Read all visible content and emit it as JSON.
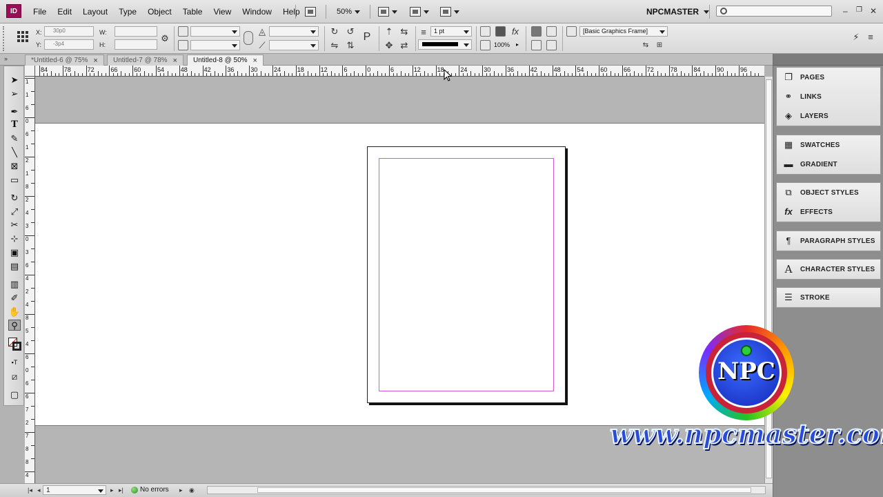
{
  "app": {
    "logo_text": "ID",
    "workspace": "NPCMASTER"
  },
  "menu": {
    "items": [
      "File",
      "Edit",
      "Layout",
      "Type",
      "Object",
      "Table",
      "View",
      "Window",
      "Help"
    ]
  },
  "menubar": {
    "zoom": "50%"
  },
  "control": {
    "x_label": "X:",
    "x_value": "30p0",
    "y_label": "Y:",
    "y_value": "-3p4",
    "w_label": "W:",
    "h_label": "H:",
    "stroke_weight": "1 pt",
    "opacity": "100%",
    "object_style": "[Basic Graphics Frame]"
  },
  "tabs": [
    {
      "label": "*Untitled-6 @ 75%",
      "close": "×"
    },
    {
      "label": "Untitled-7 @ 78%",
      "close": "×"
    },
    {
      "label": "Untitled-8 @ 50%",
      "close": "×"
    }
  ],
  "ruler": {
    "h_labels": [
      "84",
      "78",
      "72",
      "66",
      "60",
      "54",
      "48",
      "42",
      "36",
      "30",
      "24",
      "18",
      "12",
      "6",
      "0",
      "6",
      "12",
      "18",
      "24",
      "30",
      "36",
      "42",
      "48",
      "54",
      "60",
      "66",
      "72",
      "78",
      "84",
      "90",
      "96"
    ],
    "v_labels": [
      "1",
      "1",
      "6",
      "0",
      "6",
      "1",
      "2",
      "1",
      "8",
      "2",
      "4",
      "3",
      "0",
      "3",
      "6",
      "4",
      "2",
      "4",
      "8",
      "5",
      "4",
      "6",
      "0",
      "6",
      "6",
      "7",
      "2",
      "7",
      "8",
      "8",
      "4"
    ]
  },
  "status": {
    "page": "1",
    "preflight": "No errors"
  },
  "panels": [
    {
      "group": [
        {
          "icon": "pages-icon",
          "label": "PAGES"
        },
        {
          "icon": "links-icon",
          "label": "LINKS"
        },
        {
          "icon": "layers-icon",
          "label": "LAYERS"
        }
      ]
    },
    {
      "group": [
        {
          "icon": "swatches-icon",
          "label": "SWATCHES"
        },
        {
          "icon": "gradient-icon",
          "label": "GRADIENT"
        }
      ]
    },
    {
      "group": [
        {
          "icon": "object-styles-icon",
          "label": "OBJECT STYLES"
        },
        {
          "icon": "effects-icon",
          "label": "EFFECTS"
        }
      ]
    },
    {
      "group": [
        {
          "icon": "paragraph-styles-icon",
          "label": "PARAGRAPH STYLES"
        }
      ]
    },
    {
      "group": [
        {
          "icon": "character-styles-icon",
          "label": "CHARACTER STYLES"
        }
      ]
    },
    {
      "group": [
        {
          "icon": "stroke-icon",
          "label": "STROKE"
        }
      ]
    }
  ],
  "watermark": {
    "logo_letters": "NPC",
    "url": "www.npcmaster.com"
  },
  "colors": {
    "app_logo": "#9c0e57",
    "margin_guide": "#d65ad6",
    "pasteboard": "#b5b5b5"
  }
}
